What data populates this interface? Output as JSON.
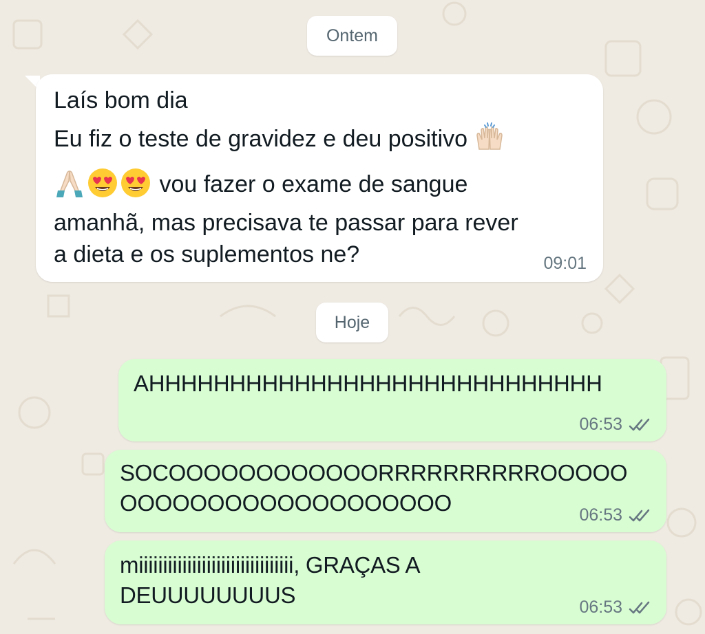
{
  "chat": {
    "date_yesterday": "Ontem",
    "date_today": "Hoje",
    "incoming": {
      "line1": "Laís bom dia",
      "line2": "Eu fiz o teste de gravidez e deu positivo",
      "line3": "vou fazer o exame de sangue",
      "line4": "amanhã, mas precisava te passar para rever",
      "line5": "a dieta e os suplementos ne?",
      "time": "09:01",
      "emojis": [
        "raising-hands-emoji",
        "folded-hands-emoji",
        "heart-eyes-emoji",
        "heart-eyes-emoji"
      ]
    },
    "outgoing": [
      {
        "lines": [
          "AHHHHHHHHHHHHHHHHHHHHHHHHHHHH"
        ],
        "time": "06:53",
        "status": "read-ticks"
      },
      {
        "lines": [
          "SOCOOOOOOOOOOOORRRRRRRRRROOOOO",
          "OOOOOOOOOOOOOOOOOOO"
        ],
        "time": "06:53",
        "status": "read-ticks"
      },
      {
        "lines": [
          "miiiiiiiiiiiiiiiiiiiiiiiiiiiiiiii, GRAÇAS A",
          "DEUUUUUUUUS"
        ],
        "time": "06:53",
        "status": "read-ticks"
      }
    ]
  },
  "colors": {
    "background": "#efeae2",
    "incoming_bubble": "#ffffff",
    "outgoing_bubble": "#d9fdd3",
    "text": "#111b21",
    "meta": "#667781"
  }
}
